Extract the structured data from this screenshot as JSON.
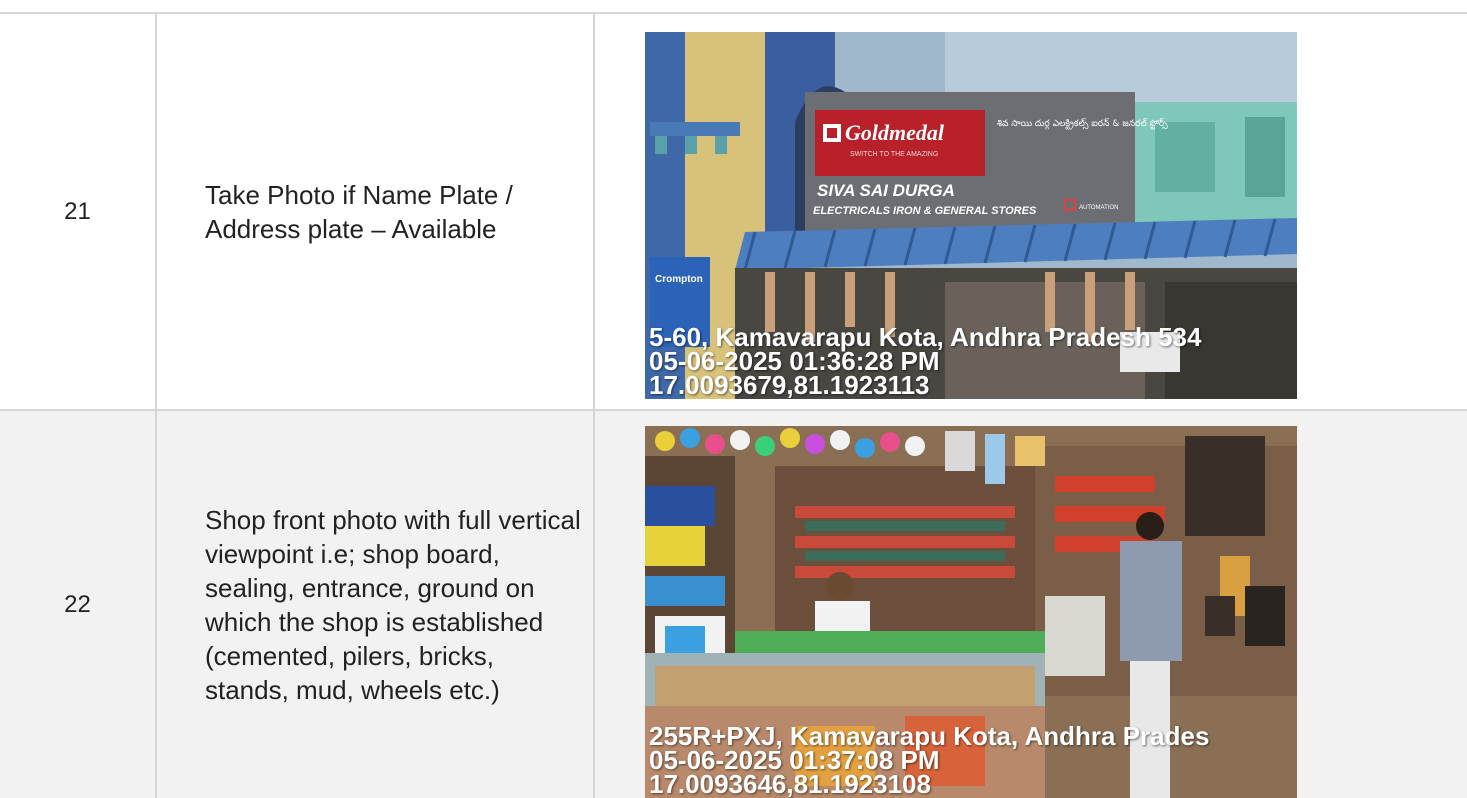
{
  "rows": [
    {
      "number": "21",
      "description": "Take Photo if Name Plate / Address plate – Available",
      "photo": {
        "sign_brand": "Goldmedal",
        "sign_tagline": "SWITCH TO THE AMAZING",
        "sign_telugu": "శివ సాయి దుర్గ ఎలక్ట్రికల్స్ ఐరన్ & జనరల్ స్టోర్స్",
        "sign_shop_name": "SIVA SAI DURGA",
        "sign_shop_sub": "ELECTRICALS IRON & GENERAL STORES",
        "sign_automation": "AUTOMATION",
        "side_sign": "Crompton",
        "stamp_address": "5-60, Kamavarapu Kota, Andhra Pradesh 534",
        "stamp_datetime": "05-06-2025 01:36:28 PM",
        "stamp_coords": "17.0093679,81.1923113"
      }
    },
    {
      "number": "22",
      "description": "Shop front photo with full vertical viewpoint i.e; shop board, sealing, entrance, ground on which the shop is established (cemented, pilers, bricks, stands, mud, wheels etc.)",
      "photo": {
        "stamp_address": "255R+PXJ, Kamavarapu Kota, Andhra Prades",
        "stamp_datetime": "05-06-2025 01:37:08 PM",
        "stamp_coords": "17.0093646,81.1923108"
      }
    }
  ]
}
